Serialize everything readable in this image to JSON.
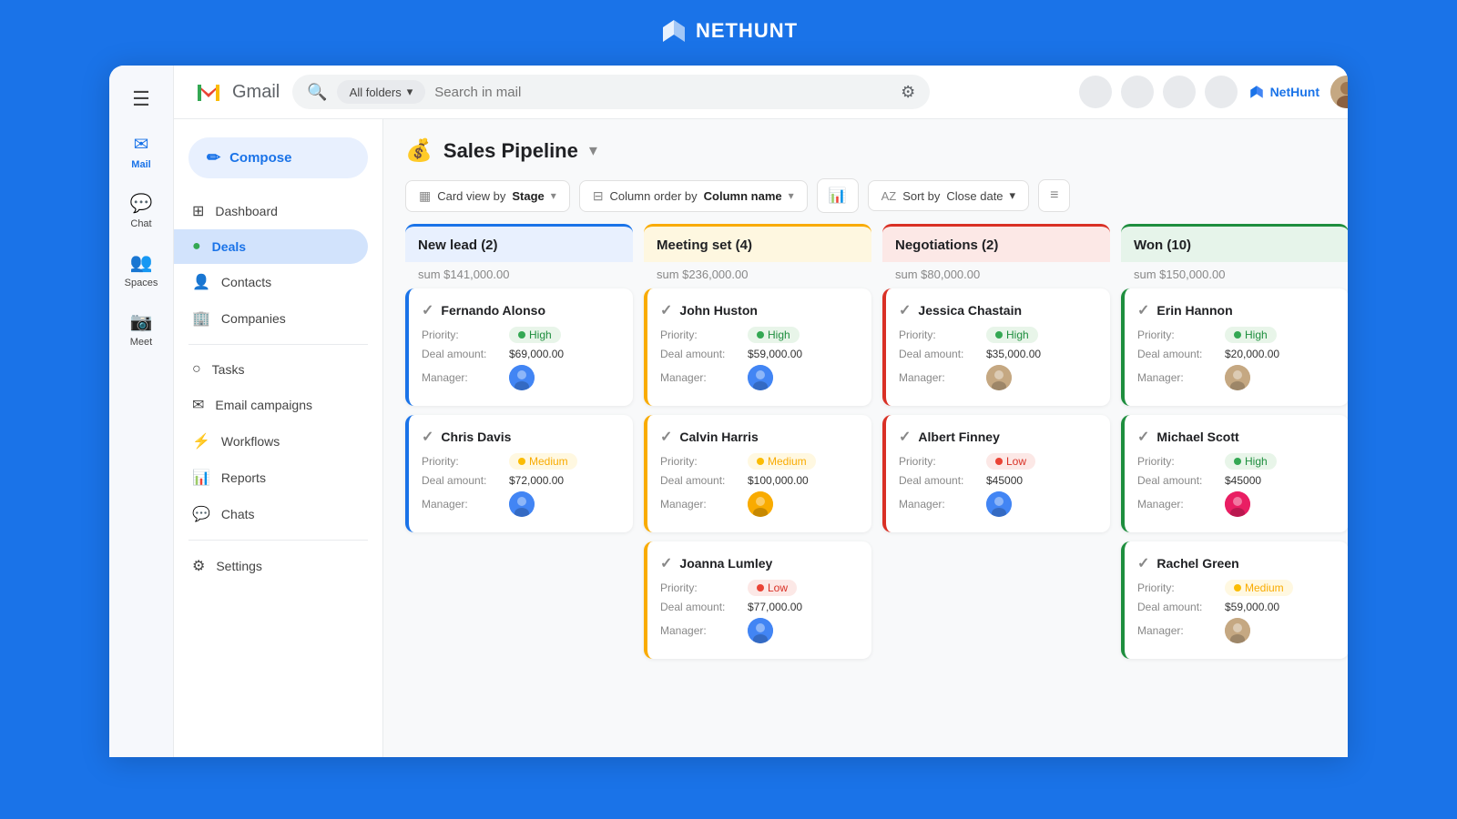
{
  "topbar": {
    "logo_text": "NETHUNT"
  },
  "gmail_header": {
    "title": "Gmail",
    "search_placeholder": "Search in mail",
    "all_folders": "All folders",
    "nethunt_brand": "NetHunt"
  },
  "gmail_sidebar": {
    "hamburger": "☰",
    "items": [
      {
        "id": "mail",
        "icon": "✉",
        "label": "Mail",
        "active": true
      },
      {
        "id": "chat",
        "icon": "💬",
        "label": "Chat",
        "active": false
      },
      {
        "id": "spaces",
        "icon": "👥",
        "label": "Spaces",
        "active": false
      },
      {
        "id": "meet",
        "icon": "📷",
        "label": "Meet",
        "active": false
      }
    ]
  },
  "app_sidebar": {
    "compose_label": "Compose",
    "nav_items": [
      {
        "id": "dashboard",
        "icon": "⊞",
        "label": "Dashboard"
      },
      {
        "id": "deals",
        "icon": "$",
        "label": "Deals",
        "active": true
      },
      {
        "id": "contacts",
        "icon": "👤",
        "label": "Contacts"
      },
      {
        "id": "companies",
        "icon": "🏢",
        "label": "Companies"
      },
      {
        "id": "tasks",
        "icon": "○",
        "label": "Tasks"
      },
      {
        "id": "email-campaigns",
        "icon": "✉",
        "label": "Email campaigns"
      },
      {
        "id": "workflows",
        "icon": "⚡",
        "label": "Workflows"
      },
      {
        "id": "reports",
        "icon": "📊",
        "label": "Reports"
      },
      {
        "id": "chats",
        "icon": "💬",
        "label": "Chats"
      },
      {
        "id": "settings",
        "icon": "⚙",
        "label": "Settings"
      }
    ]
  },
  "pipeline": {
    "title": "Sales Pipeline",
    "toolbar": {
      "card_view_label": "Card view by",
      "card_view_bold": "Stage",
      "column_order_label": "Column order by",
      "column_order_bold": "Column name",
      "sort_label": "Sort by",
      "sort_bold": "Close date"
    },
    "columns": [
      {
        "id": "new-lead",
        "title": "New lead (2)",
        "color_class": "col-blue",
        "border_class": "blue-border",
        "sum": "sum $141,000.00",
        "deals": [
          {
            "name": "Fernando Alonso",
            "priority_label": "Priority:",
            "priority": "High",
            "priority_class": "priority-high",
            "dot_class": "dot-green",
            "amount_label": "Deal amount:",
            "amount": "$69,000.00",
            "manager_label": "Manager:",
            "avatar_class": "avatar-blue"
          },
          {
            "name": "Chris Davis",
            "priority_label": "Priority:",
            "priority": "Medium",
            "priority_class": "priority-medium",
            "dot_class": "dot-orange",
            "amount_label": "Deal amount:",
            "amount": "$72,000.00",
            "manager_label": "Manager:",
            "avatar_class": "avatar-blue"
          }
        ]
      },
      {
        "id": "meeting-set",
        "title": "Meeting set (4)",
        "color_class": "col-orange",
        "border_class": "orange-border",
        "sum": "sum $236,000.00",
        "deals": [
          {
            "name": "John Huston",
            "priority_label": "Priority:",
            "priority": "High",
            "priority_class": "priority-high",
            "dot_class": "dot-green",
            "amount_label": "Deal amount:",
            "amount": "$59,000.00",
            "manager_label": "Manager:",
            "avatar_class": "avatar-blue"
          },
          {
            "name": "Calvin Harris",
            "priority_label": "Priority:",
            "priority": "Medium",
            "priority_class": "priority-medium",
            "dot_class": "dot-orange",
            "amount_label": "Deal amount:",
            "amount": "$100,000.00",
            "manager_label": "Manager:",
            "avatar_class": "avatar-orange"
          },
          {
            "name": "Joanna Lumley",
            "priority_label": "Priority:",
            "priority": "Low",
            "priority_class": "priority-low",
            "dot_class": "dot-red",
            "amount_label": "Deal amount:",
            "amount": "$77,000.00",
            "manager_label": "Manager:",
            "avatar_class": "avatar-blue"
          }
        ]
      },
      {
        "id": "negotiations",
        "title": "Negotiations (2)",
        "color_class": "col-red",
        "border_class": "red-border",
        "sum": "sum $80,000.00",
        "deals": [
          {
            "name": "Jessica Chastain",
            "priority_label": "Priority:",
            "priority": "High",
            "priority_class": "priority-high",
            "dot_class": "dot-green",
            "amount_label": "Deal amount:",
            "amount": "$35,000.00",
            "manager_label": "Manager:",
            "avatar_class": "avatar-brown"
          },
          {
            "name": "Albert Finney",
            "priority_label": "Priority:",
            "priority": "Low",
            "priority_class": "priority-low",
            "dot_class": "dot-red",
            "amount_label": "Deal amount:",
            "amount": "$45000",
            "manager_label": "Manager:",
            "avatar_class": "avatar-blue"
          }
        ]
      },
      {
        "id": "won",
        "title": "Won (10)",
        "color_class": "col-green",
        "border_class": "green-border",
        "sum": "sum $150,000.00",
        "deals": [
          {
            "name": "Erin Hannon",
            "priority_label": "Priority:",
            "priority": "High",
            "priority_class": "priority-high",
            "dot_class": "dot-green",
            "amount_label": "Deal amount:",
            "amount": "$20,000.00",
            "manager_label": "Manager:",
            "avatar_class": "avatar-brown"
          },
          {
            "name": "Michael Scott",
            "priority_label": "Priority:",
            "priority": "High",
            "priority_class": "priority-high",
            "dot_class": "dot-green",
            "amount_label": "Deal amount:",
            "amount": "$45000",
            "manager_label": "Manager:",
            "avatar_class": "avatar-pink"
          },
          {
            "name": "Rachel Green",
            "priority_label": "Priority:",
            "priority": "Medium",
            "priority_class": "priority-medium",
            "dot_class": "dot-orange",
            "amount_label": "Deal amount:",
            "amount": "$59,000.00",
            "manager_label": "Manager:",
            "avatar_class": "avatar-brown"
          }
        ]
      }
    ]
  }
}
